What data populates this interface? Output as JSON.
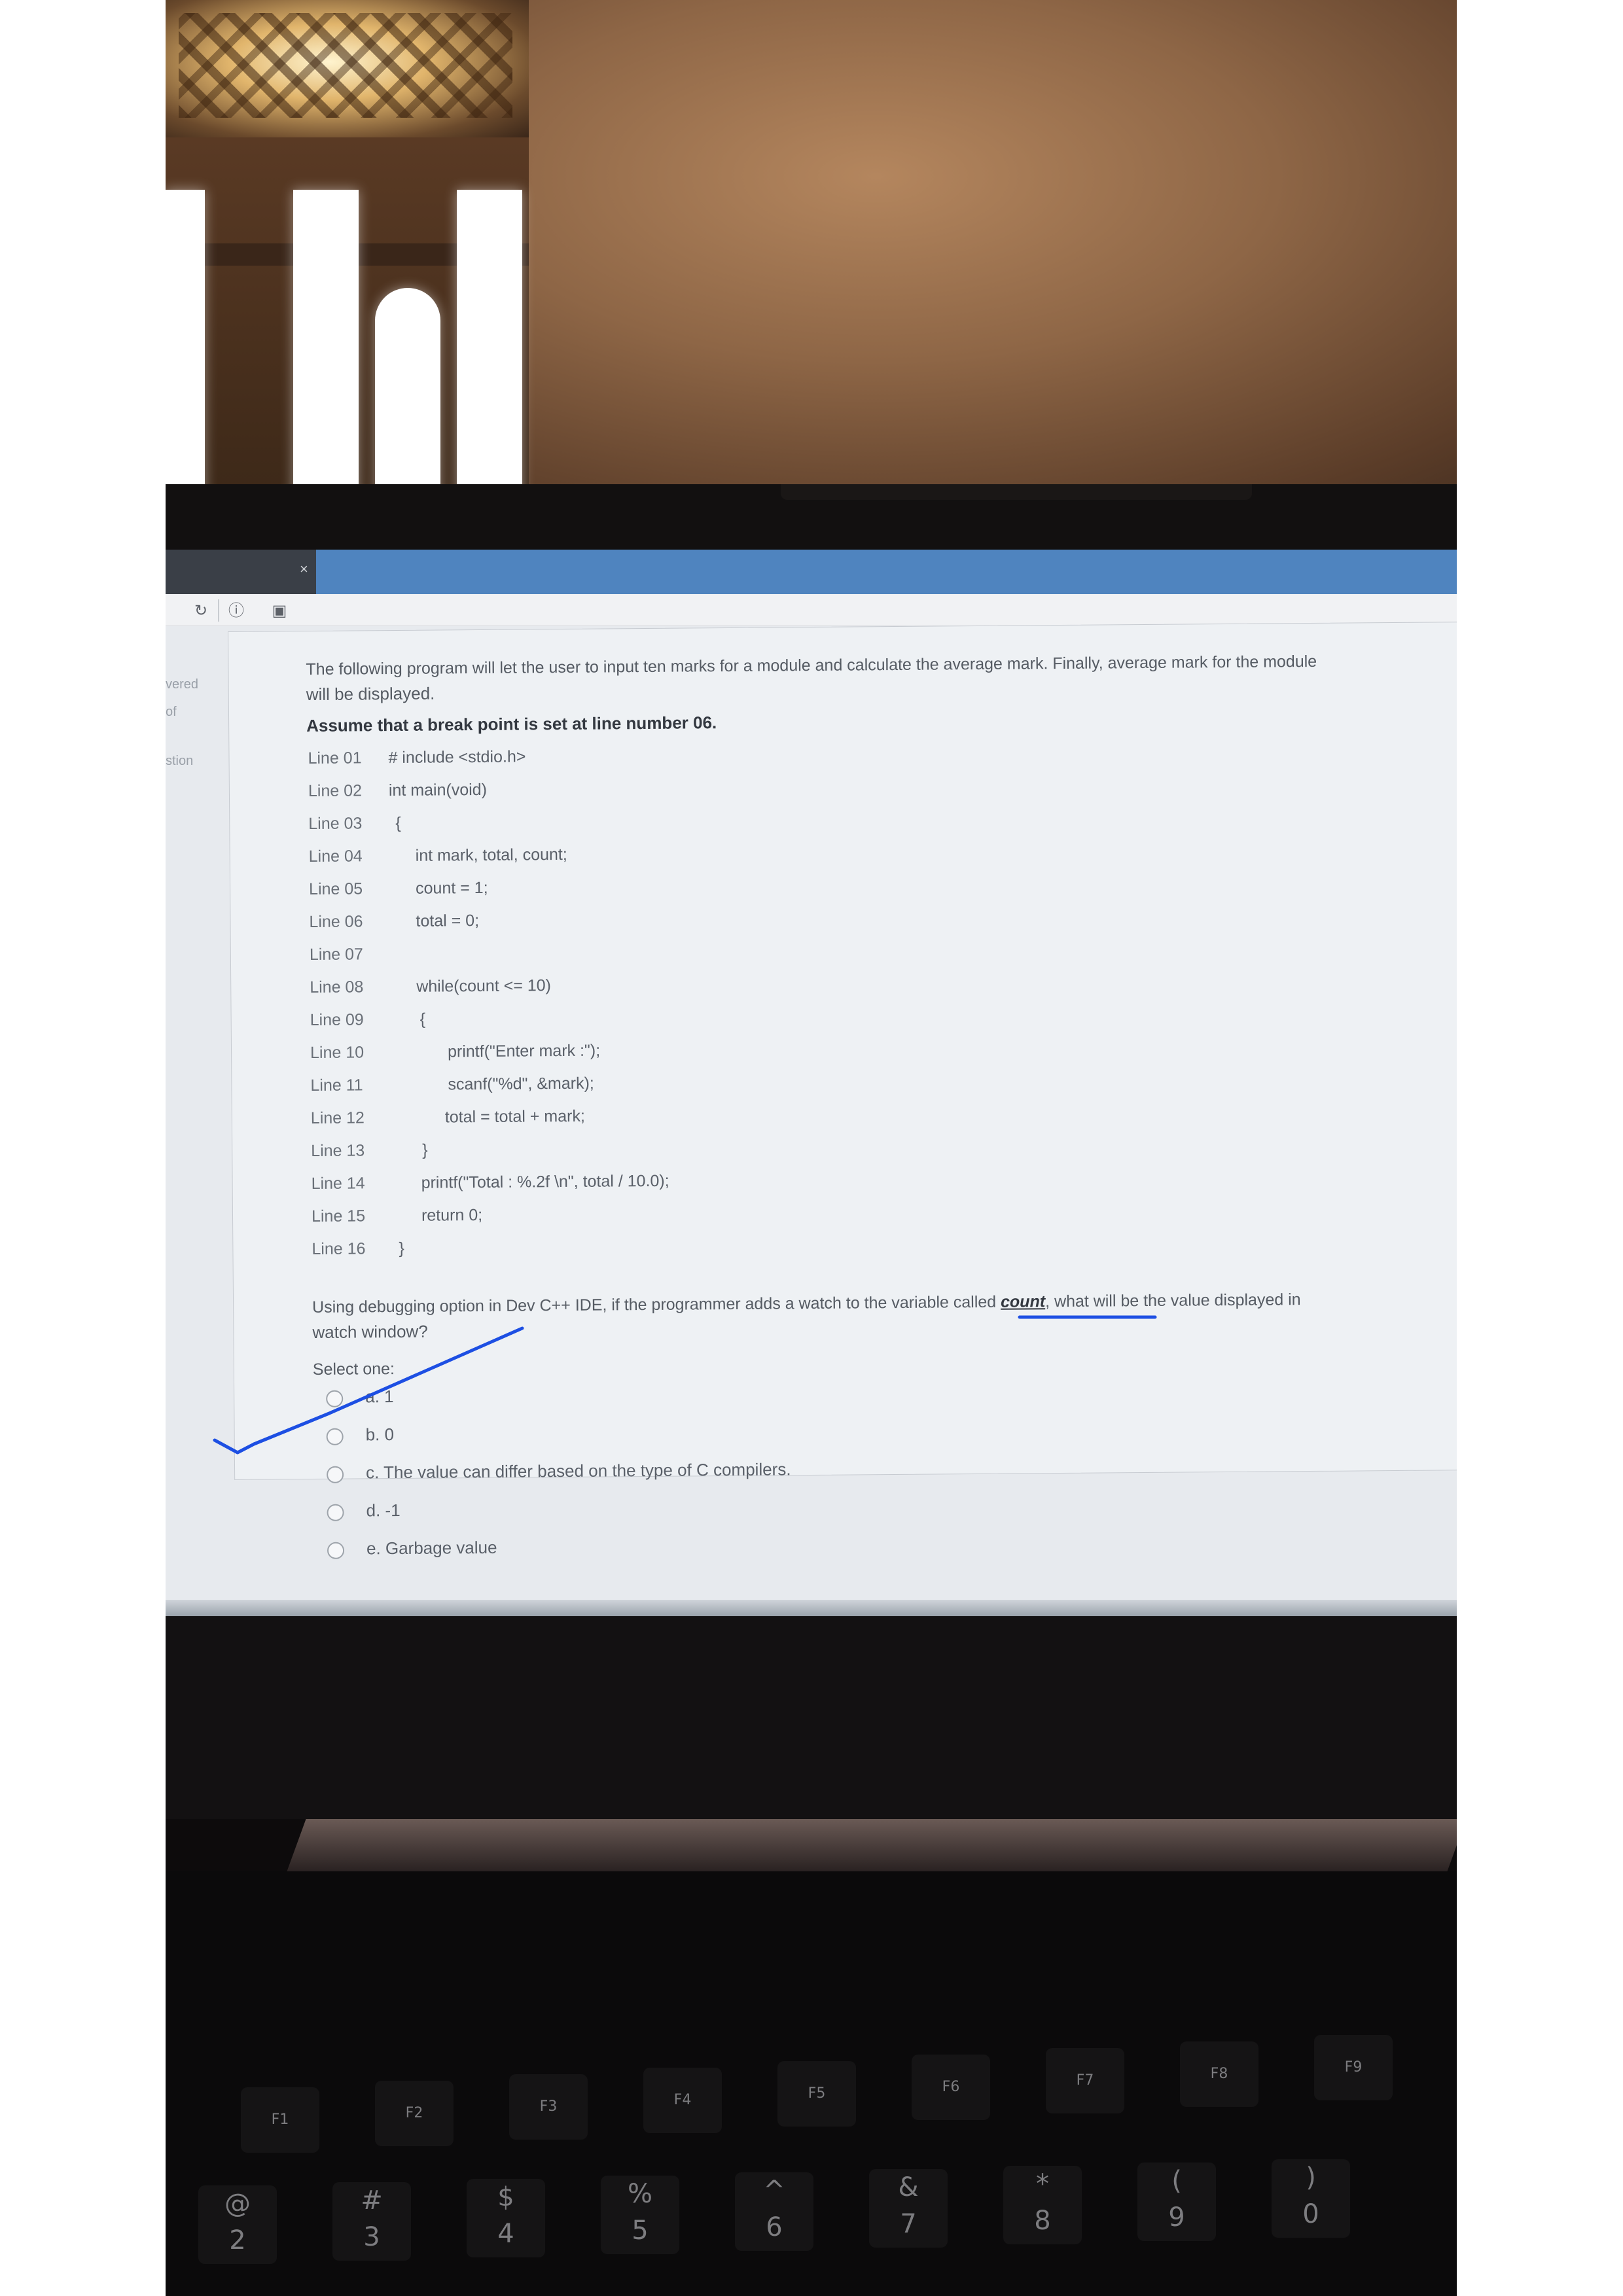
{
  "sidebar": {
    "fragments": [
      "vered",
      "of",
      "stion"
    ]
  },
  "question": {
    "intro": "The following program will let the user to input ten marks for a module and calculate the average mark. Finally, average mark for the module",
    "intro_cont": "will be displayed.",
    "assumption": "Assume that a  break point is set at line number 06.",
    "lines": [
      {
        "num": "Line 01",
        "code": "# include <stdio.h>"
      },
      {
        "num": "Line 02",
        "code": "int main(void)"
      },
      {
        "num": "Line 03",
        "code": "{"
      },
      {
        "num": "Line 04",
        "code": "int mark, total, count;"
      },
      {
        "num": "Line 05",
        "code": "count = 1;"
      },
      {
        "num": "Line 06",
        "code": "total = 0;"
      },
      {
        "num": "Line 07",
        "code": ""
      },
      {
        "num": "Line 08",
        "code": "while(count <= 10)"
      },
      {
        "num": "Line 09",
        "code": "{"
      },
      {
        "num": "Line 10",
        "code": "printf(\"Enter mark :\");"
      },
      {
        "num": "Line 11",
        "code": "scanf(\"%d\", &mark);"
      },
      {
        "num": "Line 12",
        "code": "total = total + mark;"
      },
      {
        "num": "Line 13",
        "code": "}"
      },
      {
        "num": "Line 14",
        "code": "printf(\"Total : %.2f \\n\", total / 10.0);"
      },
      {
        "num": "Line 15",
        "code": "return 0;"
      },
      {
        "num": "Line 16",
        "code": "}"
      }
    ],
    "prompt_part1": "Using debugging option in Dev C++ IDE, if the programmer adds a watch to the variable called ",
    "prompt_var": "count",
    "prompt_part2": ", what will be the value displayed in",
    "prompt_cont": "watch window?",
    "select_label": "Select one:",
    "options": [
      "a. 1",
      "b. 0",
      "c. The value can differ based on the type of C compilers.",
      "d. -1",
      "e. Garbage value"
    ]
  },
  "keyboard": {
    "fn_row": [
      "F1",
      "F2",
      "F3",
      "F4",
      "F5",
      "F6",
      "F7",
      "F8",
      "F9"
    ],
    "num_row": [
      {
        "top": "@",
        "bottom": "2"
      },
      {
        "top": "#",
        "bottom": "3"
      },
      {
        "top": "$",
        "bottom": "4"
      },
      {
        "top": "%",
        "bottom": "5"
      },
      {
        "top": "^",
        "bottom": "6"
      },
      {
        "top": "&",
        "bottom": "7"
      },
      {
        "top": "*",
        "bottom": "8"
      },
      {
        "top": "(",
        "bottom": "9"
      },
      {
        "top": ")",
        "bottom": "0"
      }
    ]
  },
  "colors": {
    "browser_bar": "#4f84bf",
    "annotation_ink": "#1d4fe3",
    "page_bg": "#eef1f4"
  }
}
